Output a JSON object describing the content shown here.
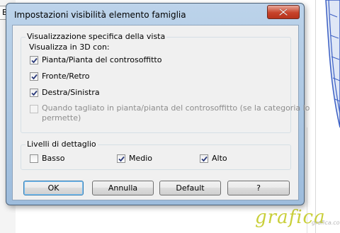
{
  "background": {
    "tab_label": "Bc",
    "watermark": "grafica",
    "watermark_sub": "grafica.com"
  },
  "dialog": {
    "title": "Impostazioni visibilità elemento famiglia",
    "close_icon": "close-x-icon",
    "view_group": {
      "legend": "Visualizzazione specifica della vista",
      "sub_label": "Visualizza in 3D con:",
      "options": [
        {
          "label": "Pianta/Pianta del controsoffitto",
          "checked": true,
          "enabled": true
        },
        {
          "label": "Fronte/Retro",
          "checked": true,
          "enabled": true
        },
        {
          "label": "Destra/Sinistra",
          "checked": true,
          "enabled": true
        },
        {
          "label_line1": "Quando tagliato in pianta/pianta del controsoffitto (se la categoria lo",
          "label_line2": "permette)",
          "checked": false,
          "enabled": false
        }
      ]
    },
    "detail_group": {
      "legend": "Livelli di dettaglio",
      "options": [
        {
          "label": "Basso",
          "checked": false
        },
        {
          "label": "Medio",
          "checked": true
        },
        {
          "label": "Alto",
          "checked": true
        }
      ]
    },
    "buttons": {
      "ok": "OK",
      "cancel": "Annulla",
      "default": "Default",
      "help": "?"
    }
  },
  "colors": {
    "accent_focus": "#3c7fb1",
    "close_button": "#c7432a",
    "watermark": "#c9cf3a"
  }
}
